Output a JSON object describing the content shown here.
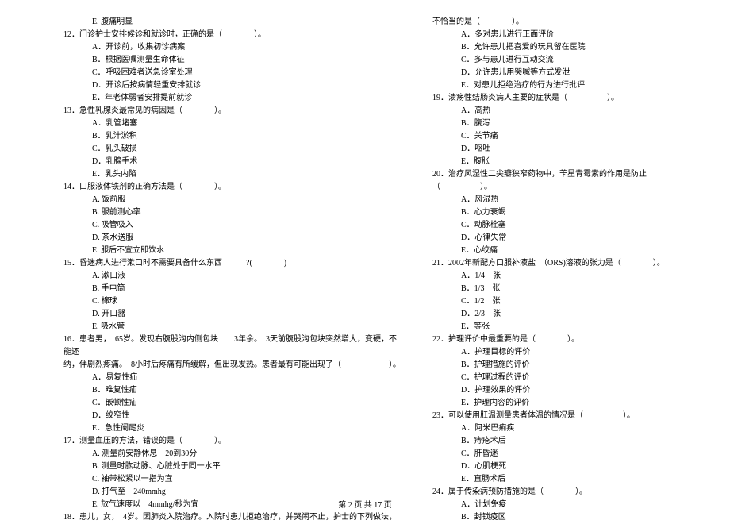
{
  "left": {
    "q11e": "E. 腹痛明显",
    "q12": {
      "num": "12．",
      "stem": "门诊护士安排候诊和就诊时，正确的是（　　　　）。",
      "opts": [
        "A．开诊前，收集初诊病案",
        "B．根据医嘱测量生命体征",
        "C．呼吸困难者送急诊室处理",
        "D．开诊后按病情轻重安排就诊",
        "E．年老体弱者安排提前就诊"
      ]
    },
    "q13": {
      "num": "13．",
      "stem": "急性乳腺炎最常见的病因是（　　　　）。",
      "opts": [
        "A．乳管堵塞",
        "B．乳汁淤积",
        "C．乳头破损",
        "D．乳腺手术",
        "E．乳头内陷"
      ]
    },
    "q14": {
      "num": "14．",
      "stem": "口服液体铁剂的正确方法是（　　　　）。",
      "opts": [
        "A. 饭前服",
        "B. 服前测心率",
        "C. 吸管吸入",
        "D. 茶水送服",
        "E. 服后不宜立即饮水"
      ]
    },
    "q15": {
      "num": "15．",
      "stem": "昏迷病人进行漱口时不需要具备什么东西　　　?(　　　　)",
      "opts": [
        "A. 漱口液",
        "B. 手电筒",
        "C. 棉球",
        "D. 开口器",
        "E. 吸水管"
      ]
    },
    "q16": {
      "num": "16．",
      "stem": "患者男，　65岁。发现右腹股沟内侧包块　　3年余。　3天前腹股沟包块突然增大，变硬，不能还",
      "stem2": "纳，伴剧烈疼痛。　8小时后疼痛有所缓解，但出现发热。患者最有可能出现了（　　　　　　）。",
      "opts": [
        "A．易复性疝",
        "B．难复性疝",
        "C．嵌顿性疝",
        "D．绞窄性",
        "E．急性阑尾炎"
      ]
    },
    "q17": {
      "num": "17．",
      "stem": "测量血压的方法，错误的是（　　　　）。",
      "opts": [
        "A. 测量前安静休息　20到30分",
        "B. 测量时肱动脉、心脏处于同一水平",
        "C. 袖带松紧以一指为宜",
        "D. 打气至　240mmhg",
        "E. 放气速度以　4mmhg/秒为宜"
      ]
    },
    "q18": {
      "num": "18．",
      "stem": "患儿，女，　4岁。因肺炎入院治疗。入院时患儿拒绝治疗，并哭闹不止，护士的下列做法，"
    }
  },
  "right": {
    "q18cont": "不恰当的是（　　　　）。",
    "q18opts": [
      "A．多对患儿进行正面评价",
      "B．允许患儿把喜爱的玩具留在医院",
      "C．多与患儿进行互动交流",
      "D．允许患儿用哭喊等方式发泄",
      "E．对患儿拒绝治疗的行为进行批评"
    ],
    "q19": {
      "num": "19．",
      "stem": "溃疡性结肠炎病人主要的症状是（　　　　　）。",
      "opts": [
        "A．高热",
        "B．腹泻",
        "C．关节痛",
        "D．呕吐",
        "E．腹胀"
      ]
    },
    "q20": {
      "num": "20．",
      "stem": "治疗风湿性二尖瓣狭窄药物中，苄星青霉素的作用是防止（　　　　　）。",
      "opts": [
        "A．风湿热",
        "B．心力衰竭",
        "C．动脉栓塞",
        "D．心律失常",
        "E．心绞痛"
      ]
    },
    "q21": {
      "num": "21．",
      "stem": "2002年新配方口服补液盐　（ORS)溶液的张力是（　　　　）。",
      "opts": [
        "A．1/4　张",
        "B．1/3　张",
        "C．1/2　张",
        "D．2/3　张",
        "E．等张"
      ]
    },
    "q22": {
      "num": "22．",
      "stem": "护理评价中最重要的是（　　　　）。",
      "opts": [
        "A．护理目标的评价",
        "B．护理措施的评价",
        "C．护理过程的评价",
        "D．护理效果的评价",
        "E．护理内容的评价"
      ]
    },
    "q23": {
      "num": "23．",
      "stem": "可以使用肛温测量患者体温的情况是（　　　　　）。",
      "opts": [
        "A．阿米巴痢疾",
        "B．痔疮术后",
        "C．肝昏迷",
        "D．心肌梗死",
        "E．直肠术后"
      ]
    },
    "q24": {
      "num": "24．",
      "stem": "属于传染病预防措施的是（　　　　）。",
      "opts": [
        "A．计划免疫",
        "B．封锁疫区"
      ]
    }
  },
  "footer": "第 2 页 共 17 页"
}
